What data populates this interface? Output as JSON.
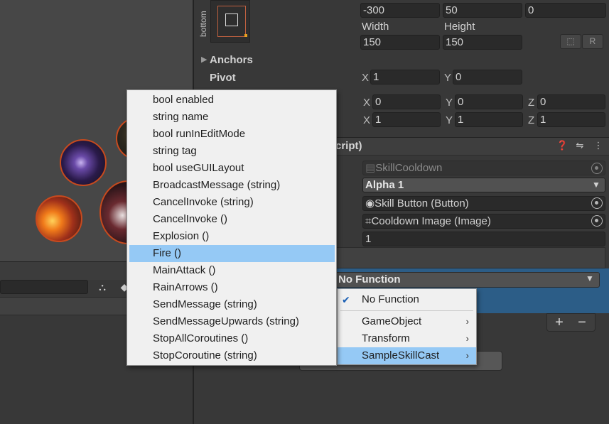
{
  "inspector": {
    "bottom_label": "bottom",
    "pos_row": [
      "-300",
      "50",
      "0"
    ],
    "width_label": "Width",
    "height_label": "Height",
    "width_value": "150",
    "height_value": "150",
    "raw_button_label": "R",
    "anchors_label": "Anchors",
    "pivot_label": "Pivot",
    "pivot": {
      "x_axis": "X",
      "x_value": "1",
      "y_axis": "Y",
      "y_value": "0"
    },
    "rotation": {
      "x_axis": "X",
      "x_value": "0",
      "y_axis": "Y",
      "y_value": "0",
      "z_axis": "Z",
      "z_value": "0"
    },
    "scale": {
      "x_axis": "X",
      "x_value": "1",
      "y_axis": "Y",
      "y_value": "1",
      "z_axis": "Z",
      "z_value": "1"
    },
    "component_title": "cript)",
    "script_field": "SkillCooldown",
    "alpha_dropdown": "Alpha 1",
    "skill_button_field": "Skill Button (Button)",
    "cooldown_image_field": "Cooldown Image (Image)",
    "number_field": "1",
    "event_function": "No Function",
    "plus_label": "+",
    "minus_label": "−"
  },
  "function_menu": {
    "items": [
      {
        "label": "No Function",
        "checked": true
      },
      {
        "label": "GameObject",
        "submenu": true
      },
      {
        "label": "Transform",
        "submenu": true
      },
      {
        "label": "SampleSkillCast",
        "submenu": true,
        "highlighted": true
      }
    ],
    "check_glyph": "✔",
    "submenu_glyph": "›"
  },
  "method_menu": {
    "items": [
      "bool enabled",
      "string name",
      "bool runInEditMode",
      "string tag",
      "bool useGUILayout",
      "BroadcastMessage (string)",
      "CancelInvoke (string)",
      "CancelInvoke ()",
      "Explosion ()",
      "Fire ()",
      "MainAttack ()",
      "RainArrows ()",
      "SendMessage (string)",
      "SendMessageUpwards (string)",
      "StopAllCoroutines ()",
      "StopCoroutine (string)"
    ],
    "highlighted_index": 9
  },
  "colors": {
    "selection_blue": "#2c5d87",
    "menu_highlight": "#95c9f5",
    "skill_ring": "#c84a1e"
  }
}
